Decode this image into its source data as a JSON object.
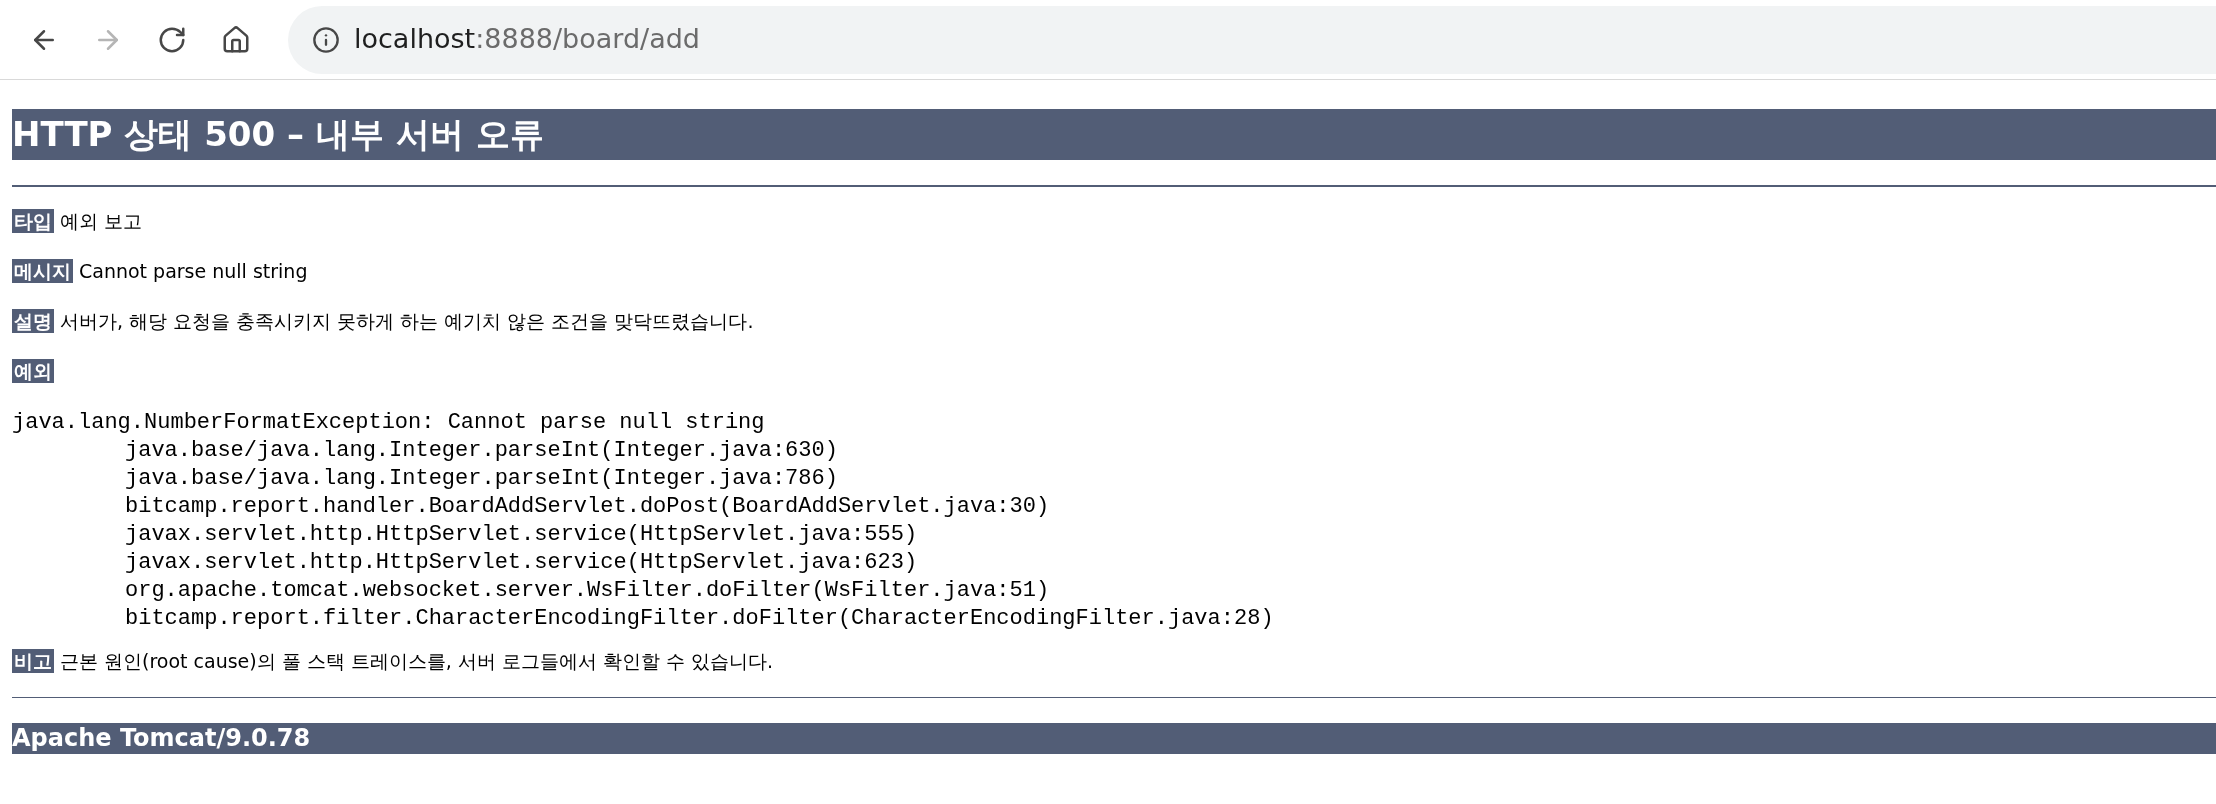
{
  "browser": {
    "nav": [
      {
        "kind": "back",
        "disabled": false
      },
      {
        "kind": "forward",
        "disabled": true
      },
      {
        "kind": "reload",
        "disabled": false
      },
      {
        "kind": "home",
        "disabled": false
      }
    ],
    "url": {
      "host": "localhost",
      "path": ":8888/board/add"
    }
  },
  "page": {
    "title": "HTTP 상태 500 – 내부 서버 오류",
    "fields": [
      {
        "label": "타입",
        "text": "예외 보고"
      },
      {
        "label": "메시지",
        "text": "Cannot parse null string"
      },
      {
        "label": "설명",
        "text": "서버가, 해당 요청을 충족시키지 못하게 하는 예기치 않은 조건을 맞닥뜨렸습니다."
      },
      {
        "label": "예외"
      }
    ],
    "exception": {
      "message": "java.lang.NumberFormatException: Cannot parse null string",
      "frames": [
        "java.base/java.lang.Integer.parseInt(Integer.java:630)",
        "java.base/java.lang.Integer.parseInt(Integer.java:786)",
        "bitcamp.report.handler.BoardAddServlet.doPost(BoardAddServlet.java:30)",
        "javax.servlet.http.HttpServlet.service(HttpServlet.java:555)",
        "javax.servlet.http.HttpServlet.service(HttpServlet.java:623)",
        "org.apache.tomcat.websocket.server.WsFilter.doFilter(WsFilter.java:51)",
        "bitcamp.report.filter.CharacterEncodingFilter.doFilter(CharacterEncodingFilter.java:28)"
      ]
    },
    "note": {
      "label": "비고",
      "text": "근본 원인(root cause)의 풀 스택 트레이스를, 서버 로그들에서 확인할 수 있습니다."
    },
    "footer": "Apache Tomcat/9.0.78"
  }
}
